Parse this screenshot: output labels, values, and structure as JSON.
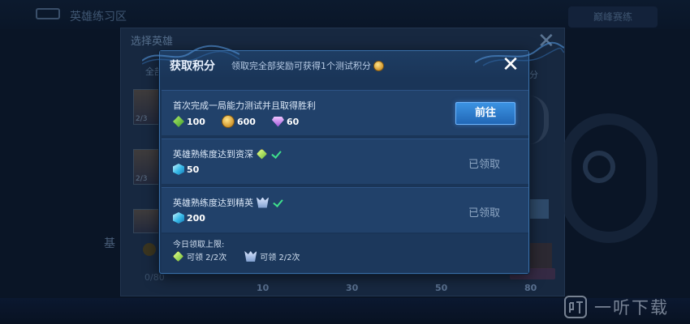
{
  "background": {
    "title": "英雄练习区",
    "right_button": "巅峰赛练",
    "panel_title": "选择英雄",
    "tab_left": "全部",
    "tab_right": "分",
    "hero_counts": [
      "2/3",
      "2/3"
    ],
    "left_label": "基",
    "fraction": "0/80",
    "ticks": [
      "10",
      "30",
      "50",
      "80"
    ]
  },
  "modal": {
    "title": "获取积分",
    "subtitle": "领取完全部奖励可获得1个测试积分",
    "close_icon": "close-icon",
    "tasks": [
      {
        "title": "首次完成一局能力测试并且取得胜利",
        "rewards": [
          {
            "icon": "green-gem-icon",
            "amount": "100"
          },
          {
            "icon": "gold-coin-icon",
            "amount": "600"
          },
          {
            "icon": "purple-crystal-icon",
            "amount": "60"
          }
        ],
        "action_label": "前往",
        "status": "pending"
      },
      {
        "title": "英雄熟练度达到资深",
        "rank_icon": "senior-rank-icon",
        "completed": true,
        "rewards": [
          {
            "icon": "cyan-cube-icon",
            "amount": "50"
          }
        ],
        "status_label": "已领取"
      },
      {
        "title": "英雄熟练度达到精英",
        "rank_icon": "elite-rank-icon",
        "completed": true,
        "rewards": [
          {
            "icon": "cyan-cube-icon",
            "amount": "200"
          }
        ],
        "status_label": "已领取"
      }
    ],
    "daily_limit": {
      "title": "今日领取上限:",
      "items": [
        {
          "icon": "senior-rank-icon",
          "text": "可领 2/2次"
        },
        {
          "icon": "elite-rank-icon",
          "text": "可领 2/2次"
        }
      ]
    }
  },
  "watermark": {
    "logo_text": "听",
    "text": "一听下载"
  },
  "colors": {
    "modal_bg": "#1a3558",
    "row_bg": "#21416a",
    "button_blue": "#2f7ed0",
    "check_green": "#3fe08c"
  }
}
